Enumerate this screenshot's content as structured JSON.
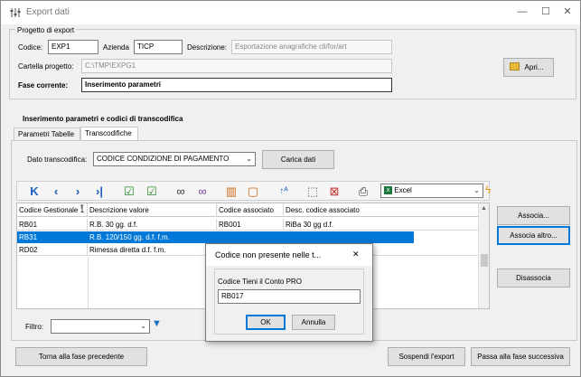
{
  "window": {
    "title": "Export dati",
    "minimize": "—",
    "maximize": "☐",
    "close": "✕"
  },
  "project": {
    "group_title": "Progetto di export",
    "codice_label": "Codice:",
    "codice_value": "EXP1",
    "azienda_label": "Azienda",
    "azienda_value": "TICP",
    "descrizione_label": "Descrizione:",
    "descrizione_value": "Esportazione anagrafiche cli/for/art",
    "cartella_label": "Cartella progetto:",
    "cartella_value": "C:\\TMP\\EXPG1",
    "fase_label": "Fase corrente:",
    "fase_value": "Inserimento parametri",
    "apri_label": "Apri..."
  },
  "section": {
    "title": "Inserimento parametri e codici di transcodifica",
    "tabs": [
      "Parametri Tabelle",
      "Transcodifiche"
    ],
    "dato_label": "Dato transcodifica:",
    "dato_value": "CODICE CONDIZIONE DI PAGAMENTO",
    "carica_label": "Carica dati"
  },
  "toolbar": {
    "export_format": "Excel"
  },
  "grid": {
    "columns": [
      "Codice Gestionale 1",
      "Descrizione valore",
      "Codice associato",
      "Desc. codice associato"
    ],
    "rows": [
      [
        "RB01",
        "R.B. 30 gg. d.f.",
        "RB001",
        "RiBa 30 gg d.f."
      ],
      [
        "RB31",
        "R.B. 120/150 gg. d.f. f.m.",
        "",
        ""
      ],
      [
        "RD02",
        "Rimessa diretta d.f. f.m.",
        "",
        ""
      ]
    ],
    "selected_row": 1
  },
  "side_buttons": {
    "associa": "Associa...",
    "associa_altro": "Associa altro...",
    "disassocia": "Disassocia"
  },
  "filter": {
    "label": "Filtro:",
    "value": ""
  },
  "footer": {
    "back": "Torna alla fase precedente",
    "suspend": "Sospendi l'export",
    "next": "Passa alla fase successiva"
  },
  "dialog": {
    "title": "Codice non presente nelle t...",
    "close": "✕",
    "field_label": "Codice Tieni il Conto PRO",
    "field_value": "RB017",
    "ok": "OK",
    "cancel": "Annulla"
  }
}
